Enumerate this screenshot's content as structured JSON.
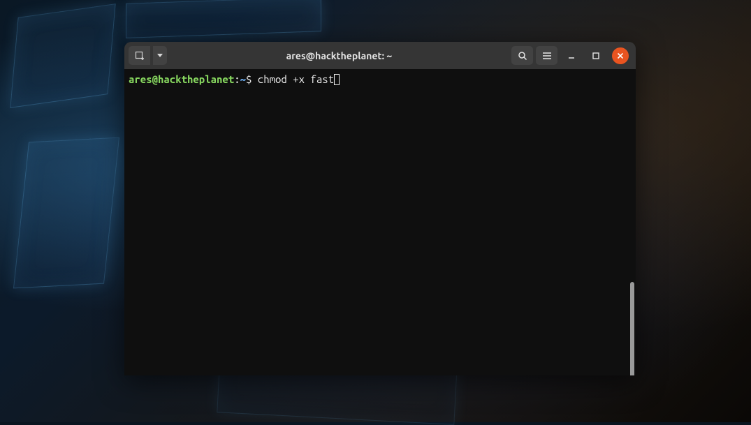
{
  "window": {
    "title": "ares@hacktheplanet: ~"
  },
  "prompt": {
    "user_host": "ares@hacktheplanet",
    "separator": ":",
    "cwd": "~",
    "symbol": "$ ",
    "command": "chmod +x fast"
  },
  "icons": {
    "new_tab": "new-tab-icon",
    "dropdown": "chevron-down-icon",
    "search": "search-icon",
    "menu": "hamburger-icon",
    "minimize": "minimize-icon",
    "maximize": "maximize-icon",
    "close": "close-icon"
  }
}
